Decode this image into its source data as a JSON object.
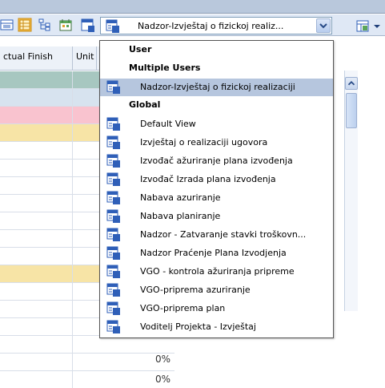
{
  "toolbar": {
    "view_combo_value": "Nadzor-Izvještaj o fizickoj realiz...",
    "icons": [
      "grid-view-icon",
      "table-view-icon",
      "tree-view-icon",
      "calendar-icon"
    ]
  },
  "grid": {
    "headers": [
      "ctual Finish",
      "Unit"
    ],
    "row_percent": [
      "0%",
      "0%",
      "0%"
    ],
    "row_colors": [
      "#a7c7c0",
      "#d7e3ef",
      "#f9c3cf",
      "#f7e4a6",
      "#ffffff",
      "#ffffff",
      "#ffffff",
      "#ffffff",
      "#ffffff",
      "#ffffff",
      "#ffffff",
      "#f7e4a6",
      "#ffffff",
      "#ffffff",
      "#ffffff",
      "#ffffff",
      "#ffffff",
      "#ffffff",
      "#ffffff"
    ]
  },
  "dropdown": {
    "items": [
      {
        "type": "group",
        "label": "User"
      },
      {
        "type": "group",
        "label": "Multiple Users"
      },
      {
        "type": "option",
        "label": "Nadzor-Izvještaj o fizickoj realizaciji",
        "selected": true
      },
      {
        "type": "group",
        "label": "Global"
      },
      {
        "type": "option",
        "label": "Default View"
      },
      {
        "type": "option",
        "label": "Izvještaj o realizaciji ugovora"
      },
      {
        "type": "option",
        "label": "Izvođač ažuriranje plana izvođenja"
      },
      {
        "type": "option",
        "label": "Izvođač Izrada plana izvođenja"
      },
      {
        "type": "option",
        "label": "Nabava azuriranje"
      },
      {
        "type": "option",
        "label": "Nabava planiranje"
      },
      {
        "type": "option",
        "label": "Nadzor - Zatvaranje stavki troškovn..."
      },
      {
        "type": "option",
        "label": "Nadzor Praćenje Plana Izvodjenja"
      },
      {
        "type": "option",
        "label": "VGO - kontrola ažuriranja pripreme"
      },
      {
        "type": "option",
        "label": "VGO-priprema azuriranje"
      },
      {
        "type": "option",
        "label": "VGO-priprema plan"
      },
      {
        "type": "option",
        "label": "Voditelj Projekta - Izvještaj"
      }
    ]
  },
  "colors": {
    "selection": "#b6c6de",
    "toolbar_bg": "#dfe8f5",
    "view_icon_blue": "#2f5fb8"
  }
}
